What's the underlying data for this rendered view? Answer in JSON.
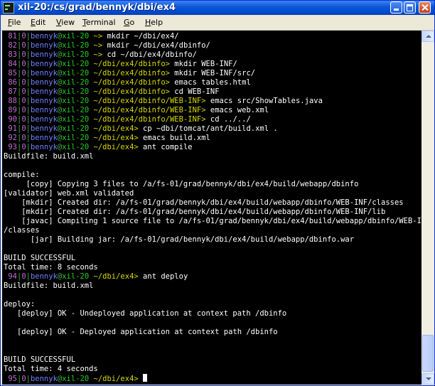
{
  "window": {
    "title": "xil-20:/cs/grad/bennyk/dbi/ex4"
  },
  "menu": [
    {
      "mnemonic": "F",
      "rest": "ile"
    },
    {
      "mnemonic": "E",
      "rest": "dit"
    },
    {
      "mnemonic": "V",
      "rest": "iew"
    },
    {
      "mnemonic": "T",
      "rest": "erminal"
    },
    {
      "mnemonic": "G",
      "rest": "o"
    },
    {
      "mnemonic": "H",
      "rest": "elp"
    }
  ],
  "terminal": {
    "prompts": [
      {
        "num": "81",
        "sep1": "|",
        "zero": "0",
        "sep2": "|",
        "user": "bennyk",
        "at": "@",
        "host": "xil-20",
        "path": "~>",
        "cmd": "mkdir ~/dbi/ex4/"
      },
      {
        "num": "82",
        "sep1": "|",
        "zero": "0",
        "sep2": "|",
        "user": "bennyk",
        "at": "@",
        "host": "xil-20",
        "path": "~>",
        "cmd": "mkdir ~/dbi/ex4/dbinfo/"
      },
      {
        "num": "83",
        "sep1": "|",
        "zero": "0",
        "sep2": "|",
        "user": "bennyk",
        "at": "@",
        "host": "xil-20",
        "path": "~>",
        "cmd": "cd ~/dbi/ex4/dbinfo/"
      },
      {
        "num": "84",
        "sep1": "|",
        "zero": "0",
        "sep2": "|",
        "user": "bennyk",
        "at": "@",
        "host": "xil-20",
        "path": "~/dbi/ex4/dbinfo>",
        "cmd": "mkdir WEB-INF/"
      },
      {
        "num": "85",
        "sep1": "|",
        "zero": "0",
        "sep2": "|",
        "user": "bennyk",
        "at": "@",
        "host": "xil-20",
        "path": "~/dbi/ex4/dbinfo>",
        "cmd": "mkdir WEB-INF/src/"
      },
      {
        "num": "86",
        "sep1": "|",
        "zero": "0",
        "sep2": "|",
        "user": "bennyk",
        "at": "@",
        "host": "xil-20",
        "path": "~/dbi/ex4/dbinfo>",
        "cmd": "emacs tables.html"
      },
      {
        "num": "87",
        "sep1": "|",
        "zero": "0",
        "sep2": "|",
        "user": "bennyk",
        "at": "@",
        "host": "xil-20",
        "path": "~/dbi/ex4/dbinfo>",
        "cmd": "cd WEB-INF"
      },
      {
        "num": "88",
        "sep1": "|",
        "zero": "0",
        "sep2": "|",
        "user": "bennyk",
        "at": "@",
        "host": "xil-20",
        "path": "~/dbi/ex4/dbinfo/WEB-INF>",
        "cmd": "emacs src/ShowTables.java"
      },
      {
        "num": "89",
        "sep1": "|",
        "zero": "0",
        "sep2": "|",
        "user": "bennyk",
        "at": "@",
        "host": "xil-20",
        "path": "~/dbi/ex4/dbinfo/WEB-INF>",
        "cmd": "emacs web.xml"
      },
      {
        "num": "90",
        "sep1": "|",
        "zero": "0",
        "sep2": "|",
        "user": "bennyk",
        "at": "@",
        "host": "xil-20",
        "path": "~/dbi/ex4/dbinfo/WEB-INF>",
        "cmd": "cd ../../"
      },
      {
        "num": "91",
        "sep1": "|",
        "zero": "0",
        "sep2": "|",
        "user": "bennyk",
        "at": "@",
        "host": "xil-20",
        "path": "~/dbi/ex4>",
        "cmd": "cp ~dbi/tomcat/ant/build.xml ."
      },
      {
        "num": "92",
        "sep1": "|",
        "zero": "0",
        "sep2": "|",
        "user": "bennyk",
        "at": "@",
        "host": "xil-20",
        "path": "~/dbi/ex4>",
        "cmd": "emacs build.xml"
      },
      {
        "num": "93",
        "sep1": "|",
        "zero": "0",
        "sep2": "|",
        "user": "bennyk",
        "at": "@",
        "host": "xil-20",
        "path": "~/dbi/ex4>",
        "cmd": "ant compile"
      },
      {
        "num": "94",
        "sep1": "|",
        "zero": "0",
        "sep2": "|",
        "user": "bennyk",
        "at": "@",
        "host": "xil-20",
        "path": "~/dbi/ex4>",
        "cmd": "ant deploy"
      },
      {
        "num": "95",
        "sep1": "|",
        "zero": "0",
        "sep2": "|",
        "user": "bennyk",
        "at": "@",
        "host": "xil-20",
        "path": "~/dbi/ex4>",
        "cmd": ""
      }
    ],
    "compile_output": [
      "Buildfile: build.xml",
      "",
      "compile:",
      "     [copy] Copying 3 files to /a/fs-01/grad/bennyk/dbi/ex4/build/webapp/dbinfo",
      "[validator] web.xml validated",
      "    [mkdir] Created dir: /a/fs-01/grad/bennyk/dbi/ex4/build/webapp/dbinfo/WEB-INF/classes",
      "    [mkdir] Created dir: /a/fs-01/grad/bennyk/dbi/ex4/build/webapp/dbinfo/WEB-INF/lib",
      "    [javac] Compiling 1 source file to /a/fs-01/grad/bennyk/dbi/ex4/build/webapp/dbinfo/WEB-INF",
      "/classes",
      "      [jar] Building jar: /a/fs-01/grad/bennyk/dbi/ex4/build/webapp/dbinfo.war",
      "",
      "BUILD SUCCESSFUL",
      "Total time: 8 seconds"
    ],
    "deploy_output": [
      "Buildfile: build.xml",
      "",
      "deploy:",
      "   [deploy] OK - Undeployed application at context path /dbinfo",
      "",
      "   [deploy] OK - Deployed application at context path /dbinfo",
      "",
      "",
      "BUILD SUCCESSFUL",
      "Total time: 4 seconds"
    ]
  },
  "colors": {
    "title_bar": "#0a56d6",
    "terminal_bg": "#000000",
    "history_number": "#c06cd0",
    "separator": "#3ab53a",
    "user": "#7080ff",
    "host": "#22cc22",
    "path": "#d8d800",
    "text": "#ffffff"
  }
}
